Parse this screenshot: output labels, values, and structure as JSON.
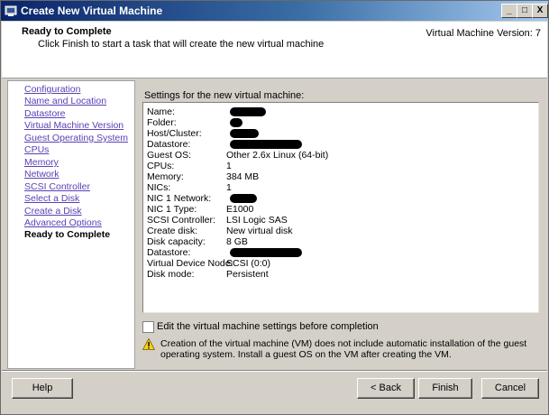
{
  "window": {
    "title": "Create New Virtual Machine",
    "controls": {
      "minimize": "_",
      "maximize": "□",
      "close": "X"
    }
  },
  "header": {
    "title": "Ready to Complete",
    "subtitle": "Click Finish to start a task that will create the new virtual machine",
    "version": "Virtual Machine Version: 7"
  },
  "nav": {
    "items": [
      {
        "label": "Configuration"
      },
      {
        "label": "Name and Location"
      },
      {
        "label": "Datastore"
      },
      {
        "label": "Virtual Machine Version"
      },
      {
        "label": "Guest Operating System"
      },
      {
        "label": "CPUs"
      },
      {
        "label": "Memory"
      },
      {
        "label": "Network"
      },
      {
        "label": "SCSI Controller"
      },
      {
        "label": "Select a Disk"
      },
      {
        "label": "Create a Disk"
      },
      {
        "label": "Advanced Options"
      },
      {
        "label": "Ready to Complete"
      }
    ]
  },
  "settings": {
    "heading": "Settings for the new virtual machine:",
    "rows": [
      {
        "key": "Name:",
        "value": ""
      },
      {
        "key": "Folder:",
        "value": ""
      },
      {
        "key": "Host/Cluster:",
        "value": ""
      },
      {
        "key": "Datastore:",
        "value": ""
      },
      {
        "key": "Guest OS:",
        "value": "Other 2.6x Linux (64-bit)"
      },
      {
        "key": "CPUs:",
        "value": "1"
      },
      {
        "key": "Memory:",
        "value": "384 MB"
      },
      {
        "key": "NICs:",
        "value": "1"
      },
      {
        "key": "NIC 1 Network:",
        "value": ""
      },
      {
        "key": "NIC 1 Type:",
        "value": "E1000"
      },
      {
        "key": "SCSI Controller:",
        "value": "LSI Logic SAS"
      },
      {
        "key": "Create disk:",
        "value": "New virtual disk"
      },
      {
        "key": "Disk capacity:",
        "value": "8 GB"
      },
      {
        "key": "Datastore:",
        "value": ""
      },
      {
        "key": "Virtual Device Node:",
        "value": "SCSI (0:0)"
      },
      {
        "key": "Disk mode:",
        "value": "Persistent"
      }
    ]
  },
  "options": {
    "edit_settings_label": "Edit the virtual machine settings before completion",
    "edit_settings_checked": false
  },
  "warning": {
    "icon": "warning-icon",
    "text": "Creation of the virtual machine (VM) does not include automatic installation of the guest operating system. Install a guest OS on the VM after creating the VM."
  },
  "buttons": {
    "help": "Help",
    "back": "< Back",
    "finish": "Finish",
    "cancel": "Cancel"
  }
}
